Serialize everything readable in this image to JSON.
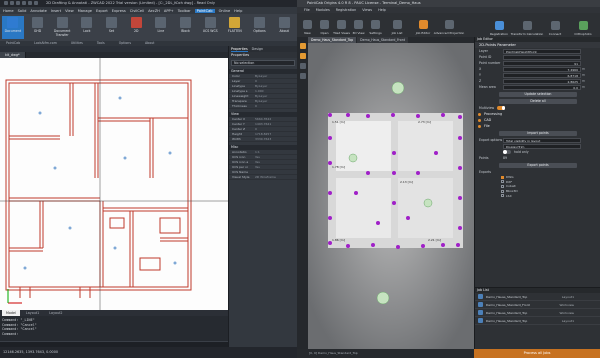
{
  "cad": {
    "title": "2D Drafting & Annotati - ZWCAD 2022 Trial version (Limited) - [C:_2DL_Küch dwg] - Read Only",
    "menu": [
      "Home",
      "Solid",
      "Annotate",
      "Insert",
      "View",
      "Manage",
      "Export",
      "Express",
      "CivilCell",
      "AecZH",
      "APP+",
      "Toolbar",
      "PointCab",
      "Online",
      "Help"
    ],
    "menu_active": "PointCab",
    "ribbon": [
      {
        "label": "Document",
        "icon": "document-icon"
      },
      {
        "label": "GHD",
        "icon": "ghd-icon"
      },
      {
        "label": "Document Transfer",
        "icon": "transfer-icon"
      },
      {
        "label": "Lock",
        "icon": "lock-icon"
      },
      {
        "label": "Set",
        "icon": "set-icon"
      },
      {
        "label": "2D",
        "icon": "2d-icon"
      },
      {
        "label": "Line",
        "icon": "line-icon"
      },
      {
        "label": "Block",
        "icon": "block-icon"
      },
      {
        "label": "UCS WCS",
        "icon": "ucs-icon"
      },
      {
        "label": "FLATTEN",
        "icon": "flatten-icon"
      },
      {
        "label": "Options",
        "icon": "options-icon"
      },
      {
        "label": "About",
        "icon": "about-icon"
      }
    ],
    "ribbon_tabs": [
      "PointCab",
      "LockAtfm.com",
      "Utilities",
      "Tools",
      "Options",
      "About"
    ],
    "doc_tab": "kit_dwg*",
    "layout_tabs": [
      "Model",
      "Layout1",
      "Layout2"
    ],
    "cmd_lines": [
      "Command: \"_LINE\"",
      "Command: \"Cancel\"",
      "Command: \"Cancel\"",
      "Command:"
    ],
    "status": "12146.2635, 1393.7643, 0.0000"
  },
  "properties": {
    "tabs": [
      "Properties",
      "Design"
    ],
    "title": "Properties",
    "selection": "No selection",
    "general_label": "General",
    "general": [
      [
        "Color",
        "ByLayer"
      ],
      [
        "Layer",
        "0"
      ],
      [
        "Linetype",
        "ByLayer"
      ],
      [
        "Linetype s",
        "1.000"
      ],
      [
        "Lineweight",
        "ByLayer"
      ],
      [
        "Transpare",
        "ByLayer"
      ],
      [
        "Thickness",
        "0"
      ]
    ],
    "view_label": "View",
    "view": [
      [
        "Center X",
        "5664.3542"
      ],
      [
        "Center Y",
        "1493.7641"
      ],
      [
        "Center Z",
        "0"
      ],
      [
        "Height",
        "1718.8257"
      ],
      [
        "Width",
        "3330.7643"
      ]
    ],
    "misc_label": "Misc",
    "misc": [
      [
        "Annotatio",
        "1:1"
      ],
      [
        "UCS icon",
        "Yes"
      ],
      [
        "UCS icon a",
        "Yes"
      ],
      [
        "UCS per vi",
        "Yes"
      ],
      [
        "UCS Name",
        ""
      ],
      [
        "Visual Style",
        "2D Wireframe"
      ]
    ]
  },
  "pc": {
    "title": "PointCab Origins 4.0 R 8 - PAUC License - Terminal_Demo_Haus",
    "menu": [
      "File",
      "Modules",
      "Registration",
      "Views",
      "Help"
    ],
    "toolbar": [
      "New",
      "Open",
      "Tiled Views",
      "3D View",
      "Settings",
      "Job List",
      "Job Editor",
      "Advanced Projection"
    ],
    "toolbar_right": [
      "Registration",
      "Transform Calculation",
      "Connect",
      "Orthophoto"
    ],
    "view_tabs": [
      "Demo_Haus_Standard_Top",
      "Demo_Haus_Standard_Front"
    ],
    "status": "[0, 0]  Demo_Haus_Standard_Top"
  },
  "panel": {
    "header": "Job Editor",
    "title": "2D-Points Parameter",
    "layer_label": "Layer",
    "layer": "PointCabHeightPoint",
    "pointid_label": "Point ID",
    "pointid": "",
    "pointnum_label": "Point number",
    "pointnum": "91",
    "x_label": "X",
    "x": "7.4960",
    "y_label": "Y",
    "y": "6.8718",
    "z_label": "Z",
    "z": "2.8625",
    "mean_label": "Mean area",
    "mean": "0.0",
    "unit": "m",
    "update_btn": "Update selection",
    "delete_btn": "Delete all",
    "multiview_label": "Multiview",
    "processing_label": "Processing",
    "cad_label": "CAD",
    "file_label": "File",
    "import_btn": "Import points",
    "export_options_label": "Export options",
    "export_options": "Total visibility in layout",
    "export_format": "Display/Trim",
    "hold_label": "hold only",
    "points_label": "Points",
    "points_value": "89",
    "export_btn": "Export points",
    "exports_label": "Exports",
    "export_types": [
      {
        "label": "DWG",
        "on": true
      },
      {
        "label": "DXF",
        "on": false
      },
      {
        "label": "Cobalt",
        "on": false
      },
      {
        "label": "Bbox3D",
        "on": false
      },
      {
        "label": "LSX",
        "on": false
      }
    ],
    "joblist_header": "Job List",
    "jobs": [
      {
        "name": "Demo_Hauss_Standard_Top",
        "type": "Layout1"
      },
      {
        "name": "Demo_Hauss_Standard_Front",
        "type": "Workview"
      },
      {
        "name": "Demo_Hauss_Standard_Top",
        "type": "Workview"
      },
      {
        "name": "Demo_Hauss_Standard_Top",
        "type": "Layout1"
      }
    ],
    "process_btn": "Process all Jobs"
  },
  "colors": {
    "accent_orange": "#e08a2c",
    "accent_blue": "#2a78c4",
    "wall_red": "#c0392b",
    "point_purple": "#a020c8"
  }
}
